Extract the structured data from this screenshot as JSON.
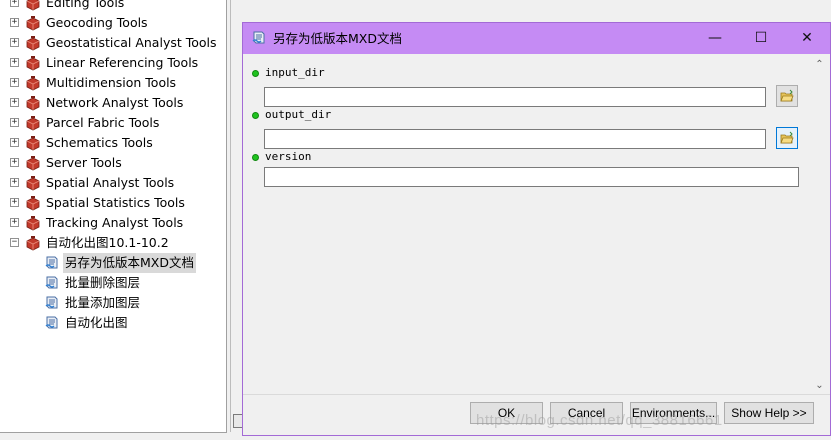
{
  "toolbox_tree": {
    "items": [
      {
        "label": "Editing Tools",
        "expander": "+"
      },
      {
        "label": "Geocoding Tools",
        "expander": "+"
      },
      {
        "label": "Geostatistical Analyst Tools",
        "expander": "+"
      },
      {
        "label": "Linear Referencing Tools",
        "expander": "+"
      },
      {
        "label": "Multidimension Tools",
        "expander": "+"
      },
      {
        "label": "Network Analyst Tools",
        "expander": "+"
      },
      {
        "label": "Parcel Fabric Tools",
        "expander": "+"
      },
      {
        "label": "Schematics Tools",
        "expander": "+"
      },
      {
        "label": "Server Tools",
        "expander": "+"
      },
      {
        "label": "Spatial Analyst Tools",
        "expander": "+"
      },
      {
        "label": "Spatial Statistics Tools",
        "expander": "+"
      },
      {
        "label": "Tracking Analyst Tools",
        "expander": "+"
      },
      {
        "label": "自动化出图10.1-10.2",
        "expander": "−"
      }
    ],
    "tools": [
      {
        "label": "另存为低版本MXD文档",
        "selected": true
      },
      {
        "label": "批量删除图层",
        "selected": false
      },
      {
        "label": "批量添加图层",
        "selected": false
      },
      {
        "label": "自动化出图",
        "selected": false
      }
    ],
    "toolbox_icon": "red-toolbox-icon",
    "tool_icon": "script-tool-icon"
  },
  "dialog": {
    "title": "另存为低版本MXD文档",
    "title_icon": "script-tool-icon",
    "window_controls": {
      "minimize": "—",
      "maximize": "☐",
      "close": "✕"
    },
    "params": [
      {
        "name": "input_dir",
        "value": "",
        "has_browse": true
      },
      {
        "name": "output_dir",
        "value": "",
        "has_browse": true
      },
      {
        "name": "version",
        "value": "",
        "has_browse": false
      }
    ],
    "buttons": {
      "ok": "OK",
      "cancel": "Cancel",
      "environments": "Environments...",
      "show_help": "Show Help >>"
    },
    "scroll": {
      "up": "⌃",
      "down": "⌄"
    }
  },
  "colors": {
    "titlebar": "#c58bf4",
    "required_dot": "#1fc21f",
    "toolbox_red": "#c23a2b"
  },
  "watermark": "https://blog.csdn.net/qq_38816661"
}
